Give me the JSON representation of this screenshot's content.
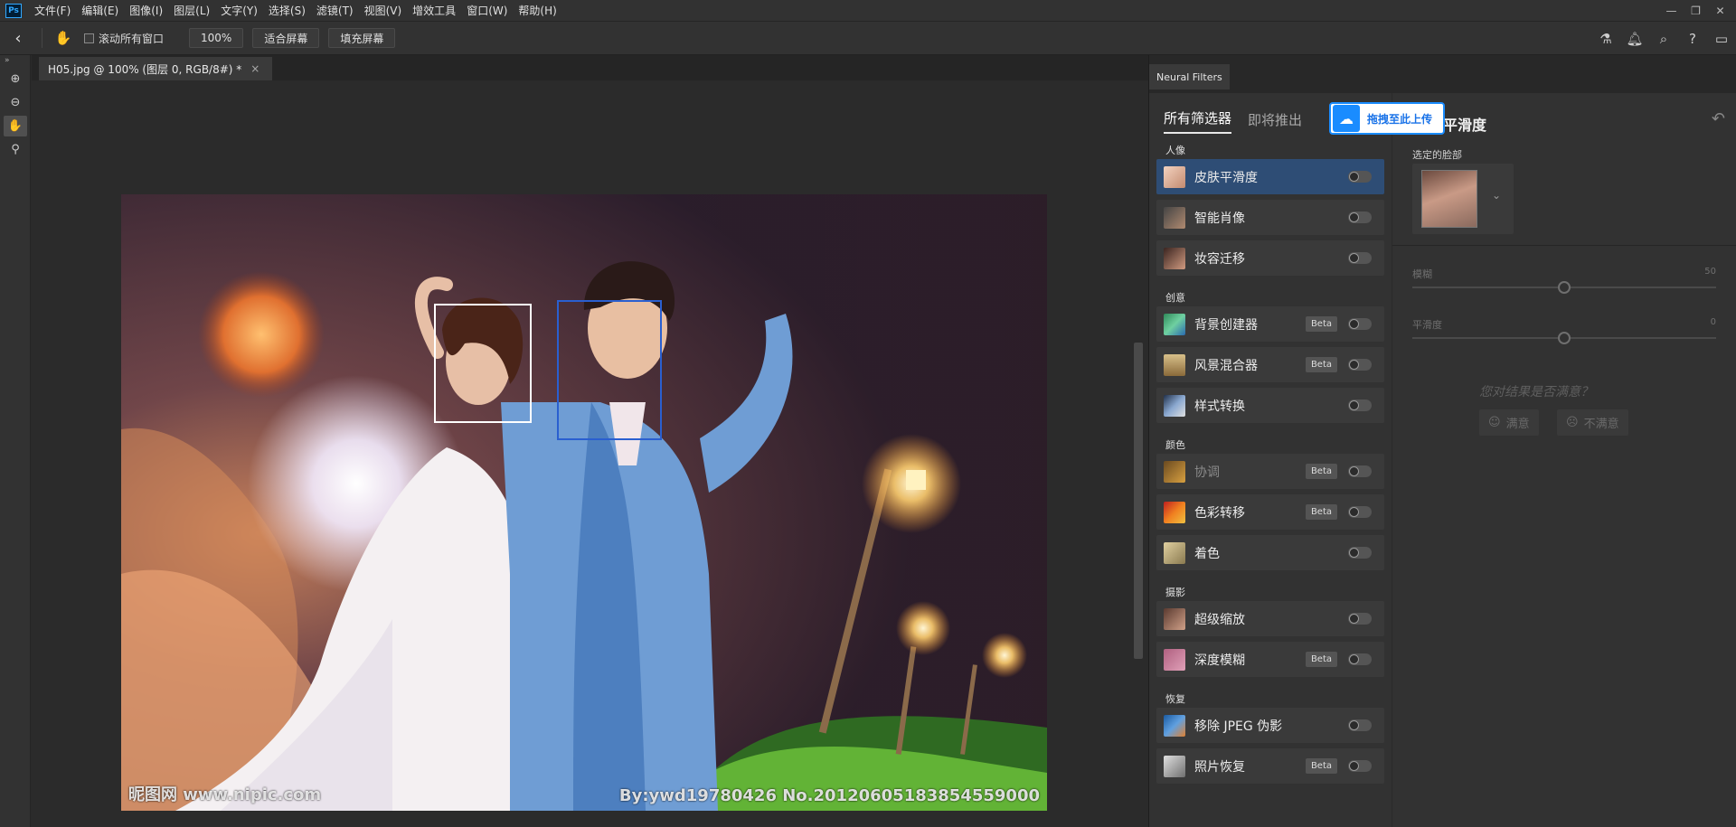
{
  "menubar": {
    "logo": "Ps",
    "items": [
      "文件(F)",
      "编辑(E)",
      "图像(I)",
      "图层(L)",
      "文字(Y)",
      "选择(S)",
      "滤镜(T)",
      "视图(V)",
      "增效工具",
      "窗口(W)",
      "帮助(H)"
    ]
  },
  "window_controls": {
    "minimize": "—",
    "restore": "❐",
    "close": "✕"
  },
  "options": {
    "scroll_all_label": "滚动所有窗口",
    "zoom_value": "100%",
    "fit_screen": "适合屏幕",
    "fill_screen": "填充屏幕"
  },
  "document": {
    "tab_title": "H05.jpg @ 100% (图层 0, RGB/8#) *",
    "close": "×"
  },
  "photo": {
    "watermark_left": "昵图网 www.nipic.com",
    "watermark_right": "By:ywd19780426  No.20120605183854559000"
  },
  "neural": {
    "panel_tab": "Neural Filters",
    "cat_all": "所有筛选器",
    "cat_soon": "即将推出",
    "groups": {
      "portrait": "人像",
      "creative": "创意",
      "color": "颜色",
      "photo": "摄影",
      "restore": "恢复"
    },
    "beta": "Beta",
    "filters": {
      "skin": "皮肤平滑度",
      "smart": "智能肖像",
      "makeup": "妆容迁移",
      "bg": "背景创建器",
      "landscape": "风景混合器",
      "style": "样式转换",
      "harmonize": "协调",
      "transfer": "色彩转移",
      "colorize": "着色",
      "super": "超级缩放",
      "depth": "深度模糊",
      "jpeg": "移除 JPEG 伪影",
      "photo_restore": "照片恢复"
    }
  },
  "settings": {
    "title": "平滑度",
    "selected_face_label": "选定的脸部",
    "blur_label": "模糊",
    "blur_value": "50",
    "smooth_label": "平滑度",
    "smooth_value": "0",
    "feedback_question": "您对结果是否满意？",
    "yes": "满意",
    "no": "不满意"
  },
  "upload": {
    "text": "拖拽至此上传"
  },
  "accent_colors": {
    "selection": "#2e4d75",
    "face_box_selected": "#2a5fd0",
    "upload": "#1a8cff"
  }
}
